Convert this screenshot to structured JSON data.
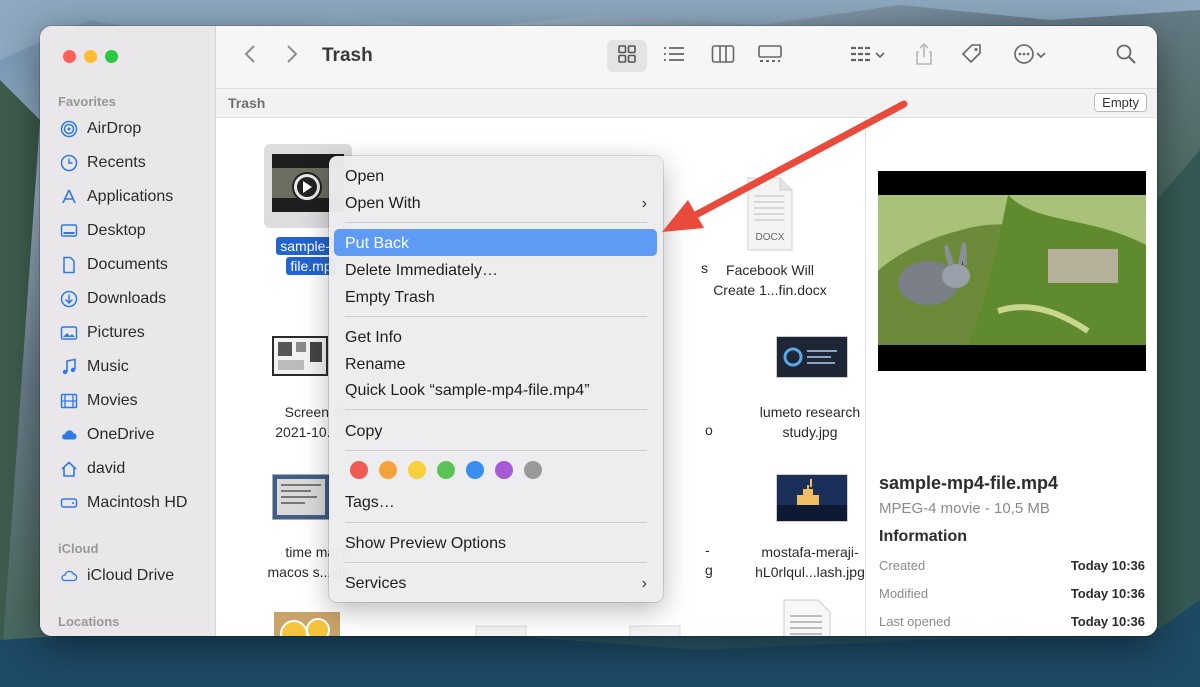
{
  "window": {
    "title": "Trash"
  },
  "sidebar": {
    "favorites_label": "Favorites",
    "icloud_label": "iCloud",
    "locations_label": "Locations",
    "favorites": [
      {
        "label": "AirDrop",
        "icon": "airdrop-icon"
      },
      {
        "label": "Recents",
        "icon": "clock-icon"
      },
      {
        "label": "Applications",
        "icon": "applications-icon"
      },
      {
        "label": "Desktop",
        "icon": "desktop-icon"
      },
      {
        "label": "Documents",
        "icon": "document-icon"
      },
      {
        "label": "Downloads",
        "icon": "download-icon"
      },
      {
        "label": "Pictures",
        "icon": "pictures-icon"
      },
      {
        "label": "Music",
        "icon": "music-icon"
      },
      {
        "label": "Movies",
        "icon": "movies-icon"
      },
      {
        "label": "OneDrive",
        "icon": "cloud-icon"
      },
      {
        "label": "david",
        "icon": "home-icon"
      },
      {
        "label": "Macintosh HD",
        "icon": "disk-icon"
      }
    ],
    "icloud": [
      {
        "label": "iCloud Drive",
        "icon": "cloud-icon"
      }
    ]
  },
  "pathbar": {
    "label": "Trash",
    "empty_button": "Empty"
  },
  "files": [
    {
      "line1": "sample-m",
      "line2": "file.mp",
      "selected": true
    },
    {
      "line1": "Facebook Will",
      "line2": "Create 1...fin.docx",
      "badge": "DOCX"
    },
    {
      "line1": "Screen Sh",
      "line2": "2021-10...0."
    },
    {
      "line1": "lumeto research",
      "line2": "study.jpg"
    },
    {
      "line1": "time mach",
      "line2": "macos s...igh"
    },
    {
      "line1": "mostafa-meraji-",
      "line2": "hL0rlqul...lash.jpg"
    }
  ],
  "partial_labels": {
    "a": "s",
    "b": "o",
    "c": "-",
    "d": "g"
  },
  "context_menu": {
    "open": "Open",
    "open_with": "Open With",
    "put_back": "Put Back",
    "delete_immediately": "Delete Immediately…",
    "empty_trash": "Empty Trash",
    "get_info": "Get Info",
    "rename": "Rename",
    "quick_look": "Quick Look “sample-mp4-file.mp4”",
    "copy": "Copy",
    "tags": "Tags…",
    "show_preview_options": "Show Preview Options",
    "services": "Services",
    "tag_colors": [
      "#ee5b53",
      "#f4a33b",
      "#f7d03b",
      "#5ec356",
      "#3a8ef0",
      "#a75ad6",
      "#9a989b"
    ]
  },
  "preview": {
    "filename": "sample-mp4-file.mp4",
    "subtitle": "MPEG-4 movie - 10,5 MB",
    "info_label": "Information",
    "rows": [
      {
        "k": "Created",
        "v": "Today 10:36"
      },
      {
        "k": "Modified",
        "v": "Today 10:36"
      },
      {
        "k": "Last opened",
        "v": "Today 10:36"
      }
    ]
  },
  "colors": {
    "accent": "#2f7ae5",
    "highlight": "#5d9bf5",
    "arrow": "#e84b3c"
  }
}
